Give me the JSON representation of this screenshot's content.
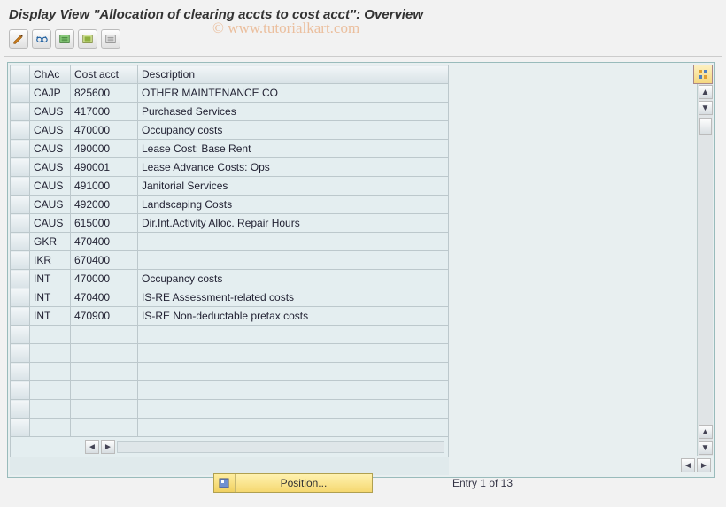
{
  "title": "Display View \"Allocation of clearing accts to cost acct\": Overview",
  "watermark": "© www.tutorialkart.com",
  "toolbar": {
    "btn1": "toggle-display-icon",
    "btn2": "glasses-icon",
    "btn3": "delimit-icon",
    "btn4": "select-all-icon",
    "btn5": "deselect-all-icon"
  },
  "columns": {
    "sel": "",
    "chac": "ChAc",
    "cost_acct": "Cost acct",
    "description": "Description"
  },
  "rows": [
    {
      "chac": "CAJP",
      "acct": "825600",
      "desc": "OTHER MAINTENANCE CO"
    },
    {
      "chac": "CAUS",
      "acct": "417000",
      "desc": "Purchased Services"
    },
    {
      "chac": "CAUS",
      "acct": "470000",
      "desc": "Occupancy costs"
    },
    {
      "chac": "CAUS",
      "acct": "490000",
      "desc": "Lease Cost: Base Rent"
    },
    {
      "chac": "CAUS",
      "acct": "490001",
      "desc": "Lease Advance Costs: Ops"
    },
    {
      "chac": "CAUS",
      "acct": "491000",
      "desc": "Janitorial Services"
    },
    {
      "chac": "CAUS",
      "acct": "492000",
      "desc": "Landscaping Costs"
    },
    {
      "chac": "CAUS",
      "acct": "615000",
      "desc": "Dir.Int.Activity Alloc. Repair Hours"
    },
    {
      "chac": "GKR",
      "acct": "470400",
      "desc": ""
    },
    {
      "chac": "IKR",
      "acct": "670400",
      "desc": ""
    },
    {
      "chac": "INT",
      "acct": "470000",
      "desc": "Occupancy costs"
    },
    {
      "chac": "INT",
      "acct": "470400",
      "desc": "IS-RE Assessment-related costs"
    },
    {
      "chac": "INT",
      "acct": "470900",
      "desc": "IS-RE Non-deductable pretax costs"
    },
    {
      "chac": "",
      "acct": "",
      "desc": ""
    },
    {
      "chac": "",
      "acct": "",
      "desc": ""
    },
    {
      "chac": "",
      "acct": "",
      "desc": ""
    },
    {
      "chac": "",
      "acct": "",
      "desc": ""
    },
    {
      "chac": "",
      "acct": "",
      "desc": ""
    },
    {
      "chac": "",
      "acct": "",
      "desc": ""
    }
  ],
  "footer": {
    "position_label": "Position...",
    "entry_text": "Entry 1 of 13"
  }
}
